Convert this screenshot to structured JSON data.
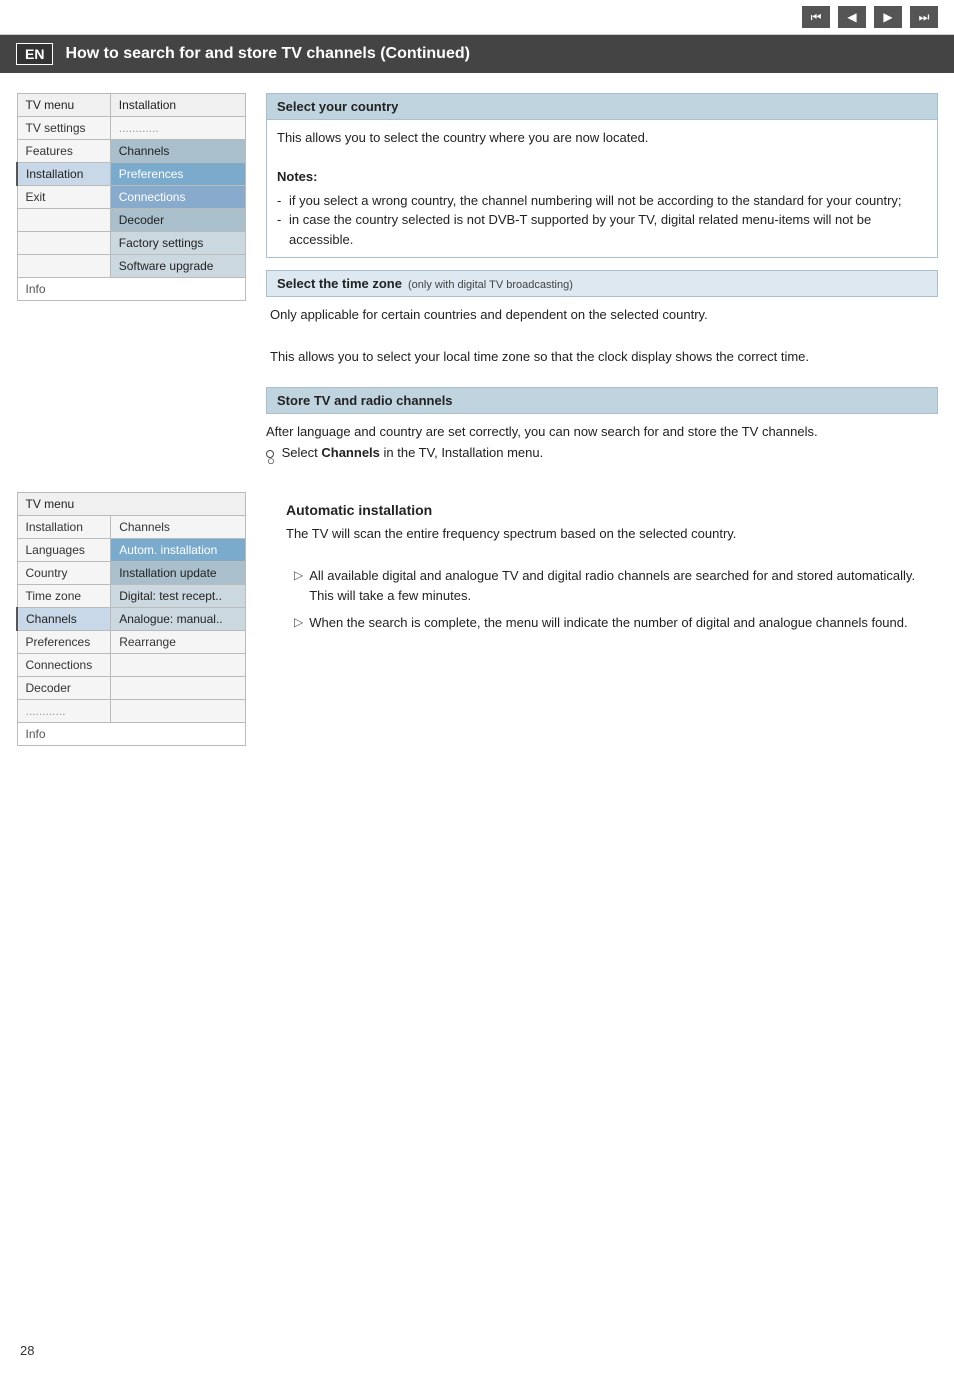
{
  "topbar": {
    "buttons": [
      "⏮",
      "◀",
      "▶",
      "⏭"
    ]
  },
  "header": {
    "lang": "EN",
    "title": "How to search for and store TV channels  (Continued)"
  },
  "menu1": {
    "header_col1": "TV menu",
    "header_col2": "Installation",
    "rows": [
      {
        "col1": "TV settings",
        "col2": "............",
        "style1": "label",
        "style2": "dots"
      },
      {
        "col1": "Features",
        "col2": "Channels",
        "style1": "label",
        "style2": "medium"
      },
      {
        "col1": "Installation",
        "col2": "Preferences",
        "style1": "selected",
        "style2": "highlighted"
      },
      {
        "col1": "Exit",
        "col2": "Connections",
        "style1": "label",
        "style2": "dark"
      },
      {
        "col1": "",
        "col2": "Decoder",
        "style1": "label",
        "style2": "medium"
      },
      {
        "col1": "",
        "col2": "Factory settings",
        "style1": "label",
        "style2": "light"
      },
      {
        "col1": "",
        "col2": "Software upgrade",
        "style1": "label",
        "style2": "light"
      }
    ],
    "info_label": "Info"
  },
  "select_country": {
    "title": "Select your country",
    "body": "This allows you to select the country where you are now located.",
    "notes_label": "Notes:",
    "notes": [
      "if you select a wrong country, the channel numbering will not be according to the standard for your country;",
      "in case the country selected is not DVB-T supported by your TV, digital related menu-items will not be accessible."
    ]
  },
  "time_zone": {
    "title": "Select the time zone",
    "subtitle": "(only with digital TV broadcasting)",
    "para1": "Only applicable for certain countries and dependent on the selected country.",
    "para2": "This allows you to select your local time zone so that the clock display shows the correct time."
  },
  "store_channels": {
    "title": "Store TV and radio channels",
    "para1": "After language and country are set correctly, you can now search for and store the TV channels.",
    "select_prefix": "Select ",
    "select_bold": "Channels",
    "select_suffix": " in the TV, Installation menu."
  },
  "auto_install": {
    "title": "Automatic installation",
    "para": "The TV will scan the entire frequency spectrum based on the selected country.",
    "items": [
      "All available digital and analogue TV and digital radio channels are searched for and stored automatically. This will take a few minutes.",
      "When the search is complete, the menu will indicate the number of digital and analogue channels found."
    ]
  },
  "menu2": {
    "header_col1": "TV menu",
    "col1_label": "Installation",
    "col2_label": "Channels",
    "rows": [
      {
        "col1": "Installation",
        "col2": "Channels",
        "style1": "label",
        "style2": "none"
      },
      {
        "col1": "Languages",
        "col2": "Autom. installation",
        "style1": "label",
        "style2": "highlighted"
      },
      {
        "col1": "Country",
        "col2": "Installation update",
        "style1": "label",
        "style2": "medium"
      },
      {
        "col1": "Time zone",
        "col2": "Digital: test recept..",
        "style1": "label",
        "style2": "light"
      },
      {
        "col1": "Channels",
        "col2": "Analogue: manual..",
        "style1": "selected",
        "style2": "light2"
      },
      {
        "col1": "Preferences",
        "col2": "Rearrange",
        "style1": "label",
        "style2": "none"
      },
      {
        "col1": "Connections",
        "col2": "",
        "style1": "label",
        "style2": "none"
      },
      {
        "col1": "Decoder",
        "col2": "",
        "style1": "label",
        "style2": "none"
      },
      {
        "col1": "............",
        "col2": "",
        "style1": "dots",
        "style2": "none"
      }
    ],
    "info_label": "Info"
  },
  "page_number": "28"
}
